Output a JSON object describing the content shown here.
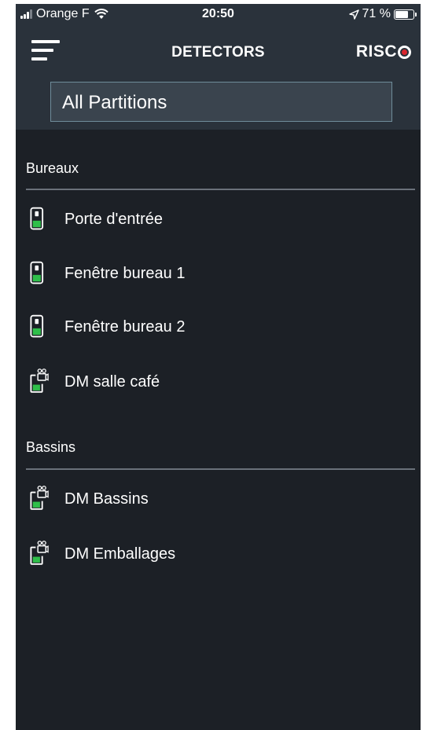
{
  "status_bar": {
    "carrier": "Orange F",
    "time": "20:50",
    "battery": "71 %"
  },
  "header": {
    "title": "DETECTORS",
    "brand": "RISC",
    "brand_accent": "#d9262d"
  },
  "partition_filter": {
    "selected": "All Partitions"
  },
  "sections": [
    {
      "title": "Bureaux",
      "detectors": [
        {
          "label": "Porte d'entrée",
          "icon": "door-contact-icon"
        },
        {
          "label": "Fenêtre bureau 1",
          "icon": "door-contact-icon"
        },
        {
          "label": "Fenêtre bureau 2",
          "icon": "door-contact-icon"
        },
        {
          "label": "DM salle café",
          "icon": "camera-motion-detector-icon"
        }
      ]
    },
    {
      "title": "Bassins",
      "detectors": [
        {
          "label": "DM Bassins",
          "icon": "camera-motion-detector-icon"
        },
        {
          "label": "DM Emballages",
          "icon": "camera-motion-detector-icon"
        }
      ]
    }
  ],
  "colors": {
    "background": "#1c2026",
    "header": "#2a323b",
    "status_ok": "#2fbf4a"
  }
}
